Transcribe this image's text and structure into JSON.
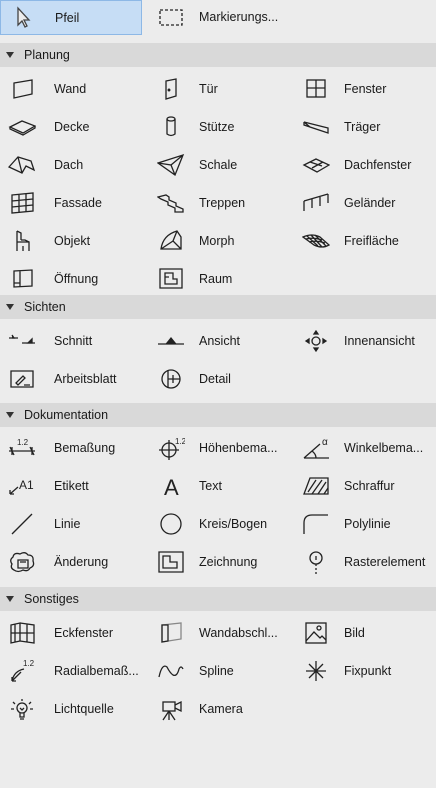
{
  "top": {
    "arrow": "Pfeil",
    "marquee": "Markierungs..."
  },
  "sections": {
    "planung": {
      "title": "Planung",
      "items": [
        "Wand",
        "Tür",
        "Fenster",
        "Decke",
        "Stütze",
        "Träger",
        "Dach",
        "Schale",
        "Dachfenster",
        "Fassade",
        "Treppen",
        "Geländer",
        "Objekt",
        "Morph",
        "Freifläche",
        "Öffnung",
        "Raum"
      ]
    },
    "sichten": {
      "title": "Sichten",
      "items": [
        "Schnitt",
        "Ansicht",
        "Innenansicht",
        "Arbeitsblatt",
        "Detail"
      ]
    },
    "dokumentation": {
      "title": "Dokumentation",
      "items": [
        "Bemaßung",
        "Höhenbema...",
        "Winkelbema...",
        "Etikett",
        "Text",
        "Schraffur",
        "Linie",
        "Kreis/Bogen",
        "Polylinie",
        "Änderung",
        "Zeichnung",
        "Rasterelement"
      ]
    },
    "sonstiges": {
      "title": "Sonstiges",
      "items": [
        "Eckfenster",
        "Wandabschl...",
        "Bild",
        "Radialbemaß...",
        "Spline",
        "Fixpunkt",
        "Lichtquelle",
        "Kamera"
      ]
    }
  },
  "icon_text": {
    "dim": "1.2",
    "label_a1": "A1",
    "text_a": "A",
    "alpha": "α"
  },
  "colors": {
    "background": "#ececec",
    "section_header": "#d9d9d9",
    "selected": "#c6ddf5"
  }
}
